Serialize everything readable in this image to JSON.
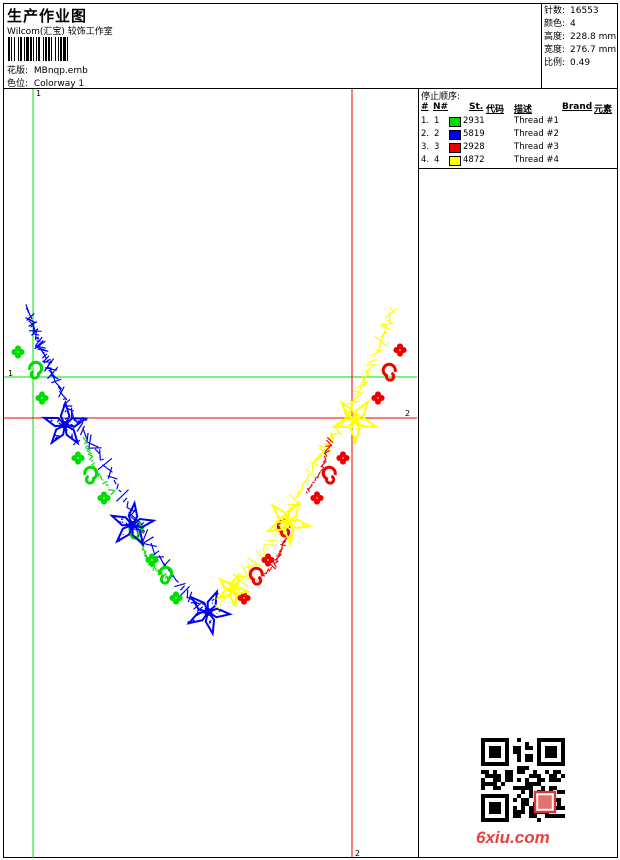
{
  "header": {
    "title": "生产作业图",
    "subtitle": "Wilcom(汇宝) 较饰工作室",
    "design_label": "花版:",
    "design_value": "MBnqp.emb",
    "colorway_label": "色位:",
    "colorway_value": "Colorway 1"
  },
  "stats": [
    {
      "label": "针数:",
      "value": "16553"
    },
    {
      "label": "颜色:",
      "value": "4"
    },
    {
      "label": "高度:",
      "value": "228.8 mm"
    },
    {
      "label": "宽度:",
      "value": "276.7 mm"
    },
    {
      "label": "比例:",
      "value": "0.49"
    }
  ],
  "stop_sequence": {
    "title": "停止顺序:",
    "headers": {
      "num": "#",
      "needle": "N#",
      "st": "St.",
      "code": "代码",
      "desc": "描述",
      "brand": "Brand",
      "elem": "元素"
    },
    "rows": [
      {
        "idx": "1.",
        "needle": "1",
        "color": "#00dd00",
        "code": "2931",
        "desc": "Thread #1"
      },
      {
        "idx": "2.",
        "needle": "2",
        "color": "#0000ee",
        "code": "5819",
        "desc": "Thread #2"
      },
      {
        "idx": "3.",
        "needle": "3",
        "color": "#ee0000",
        "code": "2928",
        "desc": "Thread #3"
      },
      {
        "idx": "4.",
        "needle": "4",
        "color": "#ffff00",
        "code": "4872",
        "desc": "Thread #4"
      }
    ]
  },
  "guides": {
    "green_v": "1",
    "green_h": "1",
    "red_h": "2",
    "red_v": "2"
  },
  "colors": {
    "green": "#00dd00",
    "blue": "#0000ee",
    "red": "#ee0000",
    "yellow": "#ffff00"
  },
  "watermark": "6xiu.com"
}
